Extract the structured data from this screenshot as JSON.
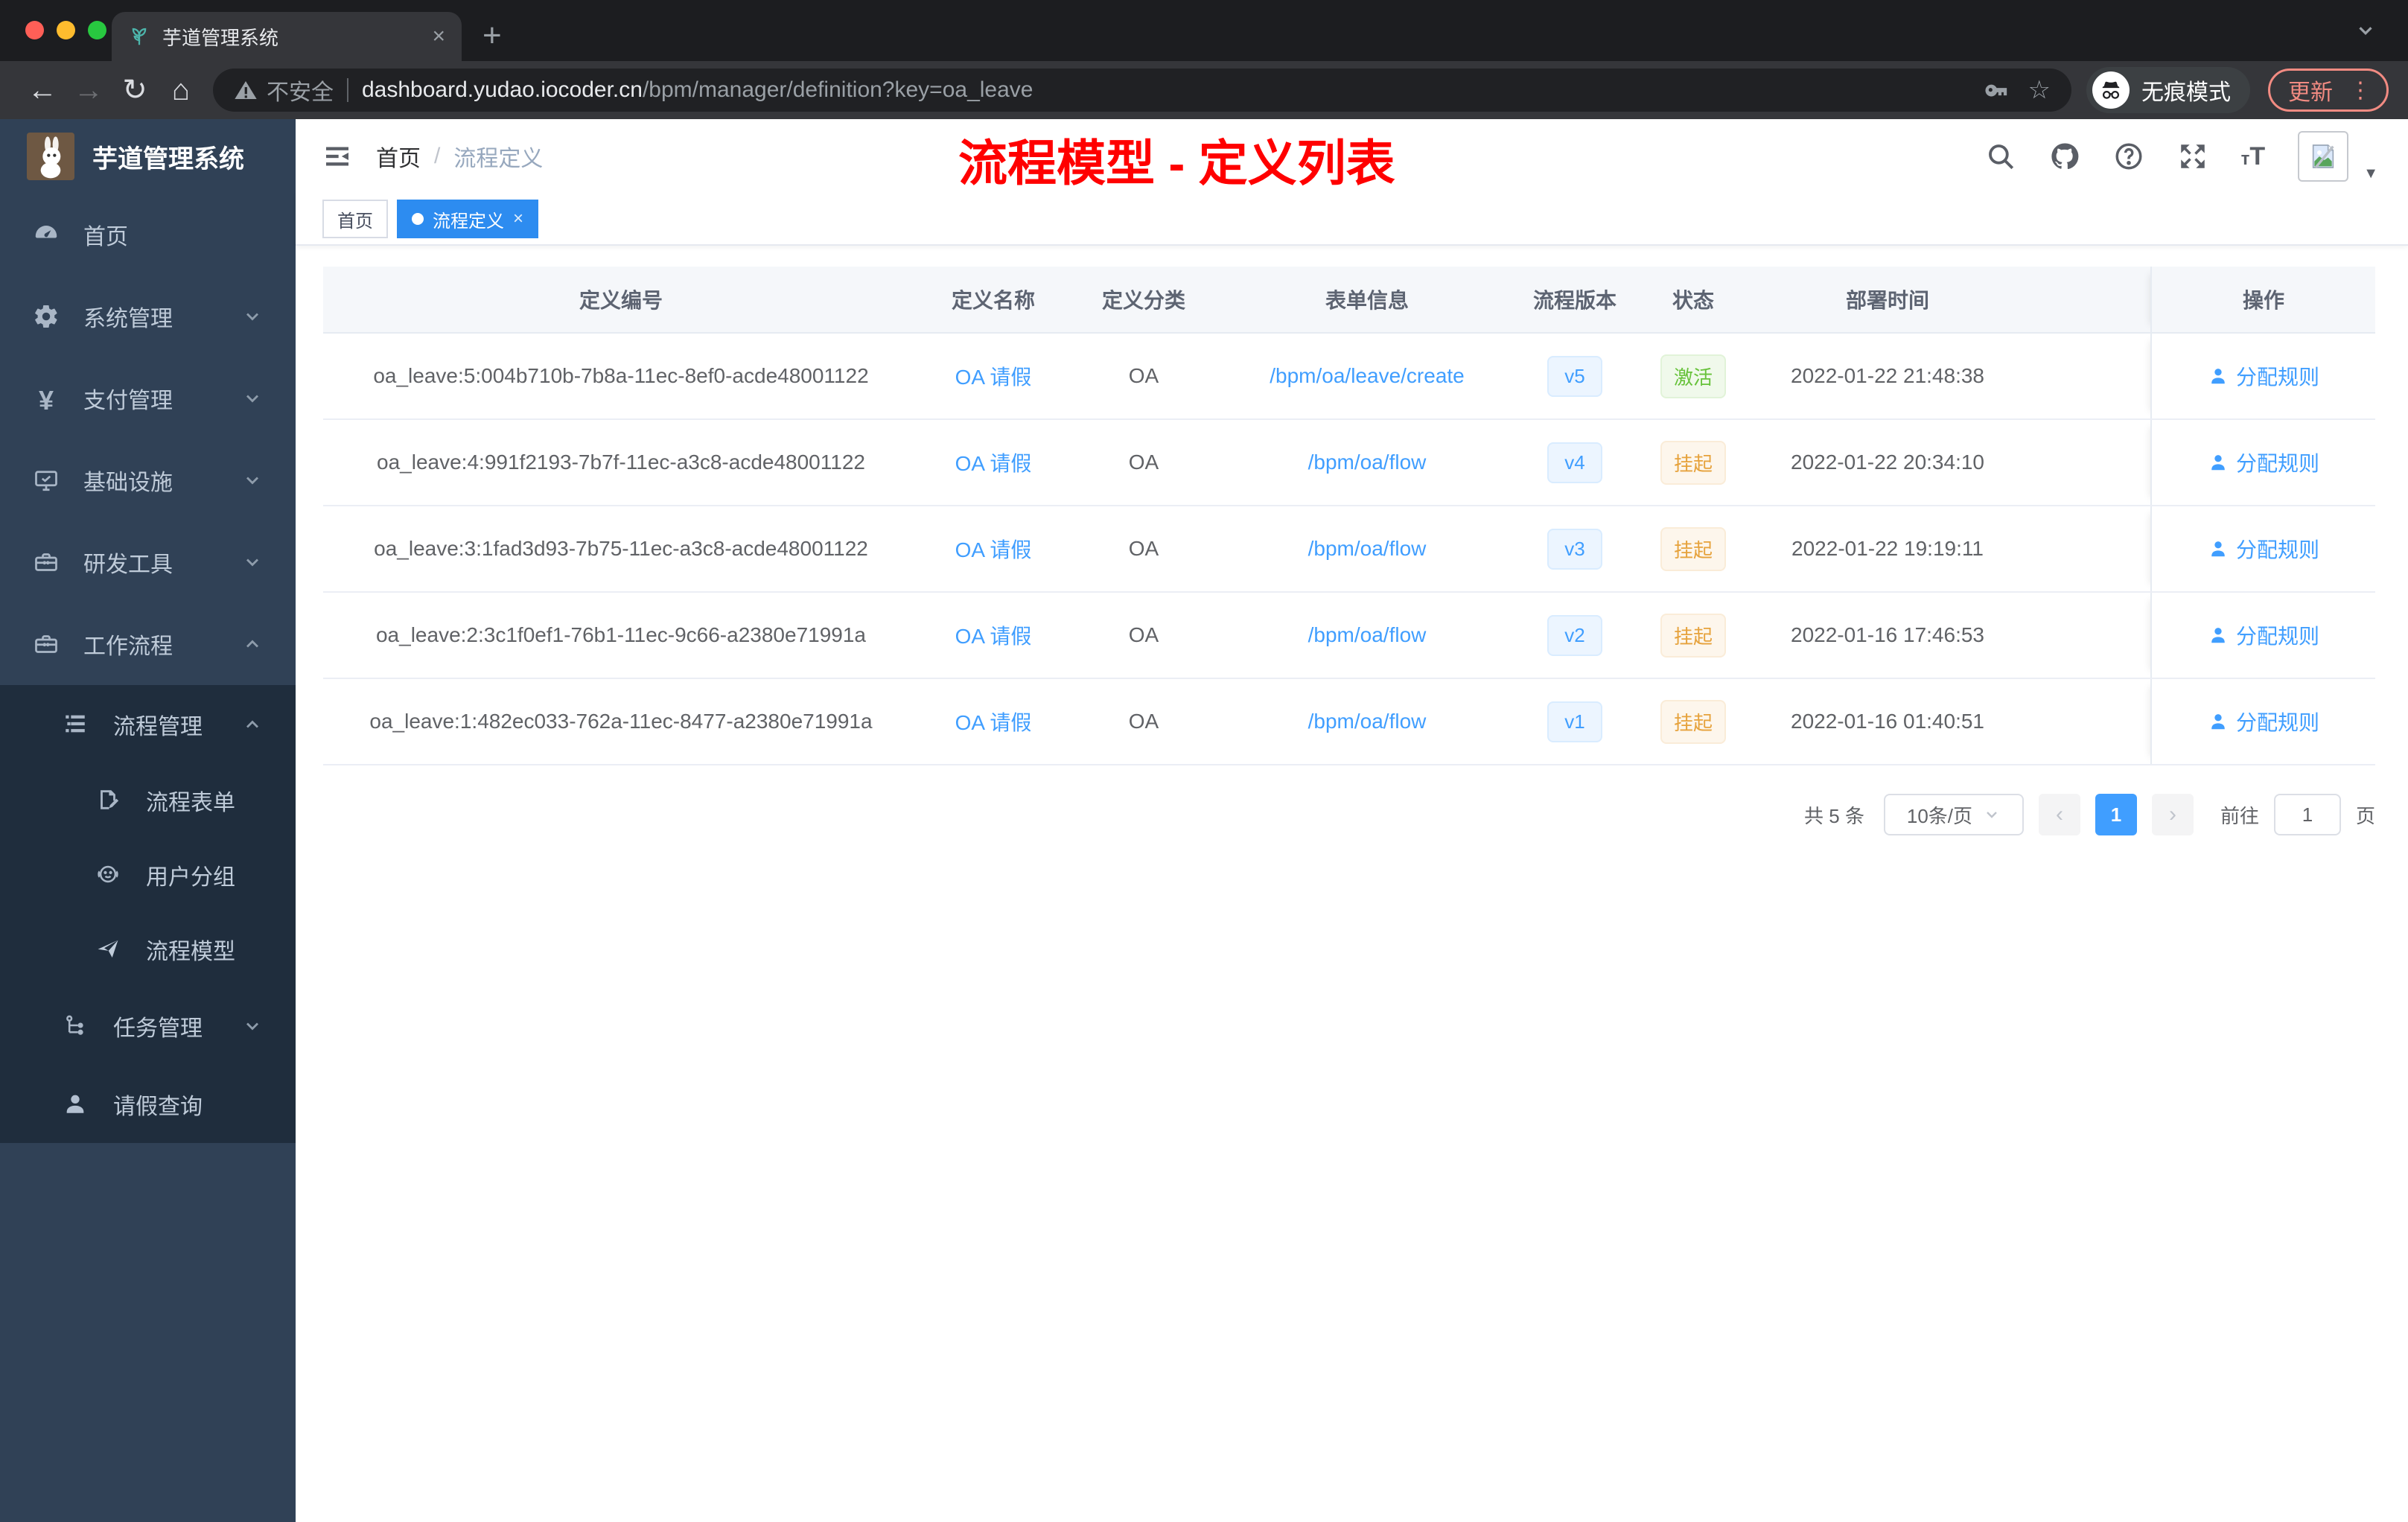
{
  "browser": {
    "tab_title": "芋道管理系统",
    "security_label": "不安全",
    "url_host": "dashboard.yudao.iocoder.cn",
    "url_path": "/bpm/manager/definition?key=oa_leave",
    "incognito_label": "无痕模式",
    "update_label": "更新"
  },
  "icons": {
    "close": "×",
    "plus": "+",
    "back": "←",
    "forward": "→",
    "reload": "↻",
    "home": "⌂",
    "star": "☆",
    "more": "⋮",
    "slash": "/",
    "prev": "‹",
    "next": "›",
    "caret": "▼",
    "font_small": "т",
    "font_large": "T"
  },
  "sidebar": {
    "logo_title": "芋道管理系统",
    "menu": [
      {
        "label": "首页"
      },
      {
        "label": "系统管理"
      },
      {
        "label": "支付管理"
      },
      {
        "label": "基础设施"
      },
      {
        "label": "研发工具"
      },
      {
        "label": "工作流程"
      },
      {
        "label": "流程管理"
      },
      {
        "label": "流程表单"
      },
      {
        "label": "用户分组"
      },
      {
        "label": "流程模型"
      },
      {
        "label": "任务管理"
      },
      {
        "label": "请假查询"
      }
    ]
  },
  "header": {
    "breadcrumb_home": "首页",
    "breadcrumb_current": "流程定义",
    "annotation": "流程模型 - 定义列表"
  },
  "tags": [
    {
      "label": "首页"
    },
    {
      "label": "流程定义"
    }
  ],
  "table": {
    "columns": [
      "定义编号",
      "定义名称",
      "定义分类",
      "表单信息",
      "流程版本",
      "状态",
      "部署时间",
      "操作"
    ],
    "rows": [
      {
        "id": "oa_leave:5:004b710b-7b8a-11ec-8ef0-acde48001122",
        "name": "OA 请假",
        "category": "OA",
        "form": "/bpm/oa/leave/create",
        "version": "v5",
        "status": "激活",
        "time": "2022-01-22 21:48:38",
        "action": "分配规则"
      },
      {
        "id": "oa_leave:4:991f2193-7b7f-11ec-a3c8-acde48001122",
        "name": "OA 请假",
        "category": "OA",
        "form": "/bpm/oa/flow",
        "version": "v4",
        "status": "挂起",
        "time": "2022-01-22 20:34:10",
        "action": "分配规则"
      },
      {
        "id": "oa_leave:3:1fad3d93-7b75-11ec-a3c8-acde48001122",
        "name": "OA 请假",
        "category": "OA",
        "form": "/bpm/oa/flow",
        "version": "v3",
        "status": "挂起",
        "time": "2022-01-22 19:19:11",
        "action": "分配规则"
      },
      {
        "id": "oa_leave:2:3c1f0ef1-76b1-11ec-9c66-a2380e71991a",
        "name": "OA 请假",
        "category": "OA",
        "form": "/bpm/oa/flow",
        "version": "v2",
        "status": "挂起",
        "time": "2022-01-16 17:46:53",
        "action": "分配规则"
      },
      {
        "id": "oa_leave:1:482ec033-762a-11ec-8477-a2380e71991a",
        "name": "OA 请假",
        "category": "OA",
        "form": "/bpm/oa/flow",
        "version": "v1",
        "status": "挂起",
        "time": "2022-01-16 01:40:51",
        "action": "分配规则"
      }
    ]
  },
  "pagination": {
    "total": "共 5 条",
    "page_size": "10条/页",
    "current_page": "1",
    "goto_label": "前往",
    "goto_value": "1",
    "page_unit": "页"
  },
  "colors": {
    "accent_blue": "#409eff",
    "success_green": "#67c23a",
    "warning_orange": "#e6a23c",
    "annotation_red": "#ff0000",
    "sidebar_bg": "#304156",
    "submenu_bg": "#1f2d3d"
  }
}
